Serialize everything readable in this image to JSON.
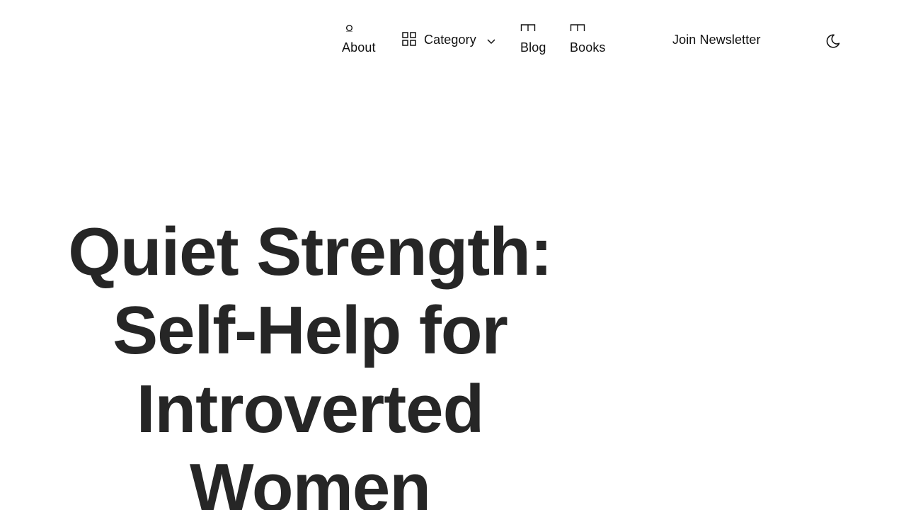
{
  "header": {
    "nav": {
      "about": {
        "label": "About",
        "icon": "circle-icon"
      },
      "category": {
        "label": "Category",
        "icon": "grid-icon",
        "dropdown_icon": "chevron-down-icon"
      },
      "blog": {
        "label": "Blog",
        "icon": "m-glyph-icon"
      },
      "books": {
        "label": "Books",
        "icon": "m-glyph-icon"
      }
    },
    "newsletter_label": "Join Newsletter",
    "theme_toggle_icon": "moon-icon"
  },
  "hero": {
    "title_lines": [
      "Quiet Strength:",
      "Self-Help for",
      "Introverted",
      "Women"
    ]
  },
  "colors": {
    "background": "#ffffff",
    "text": "#111111",
    "title": "#262626"
  }
}
